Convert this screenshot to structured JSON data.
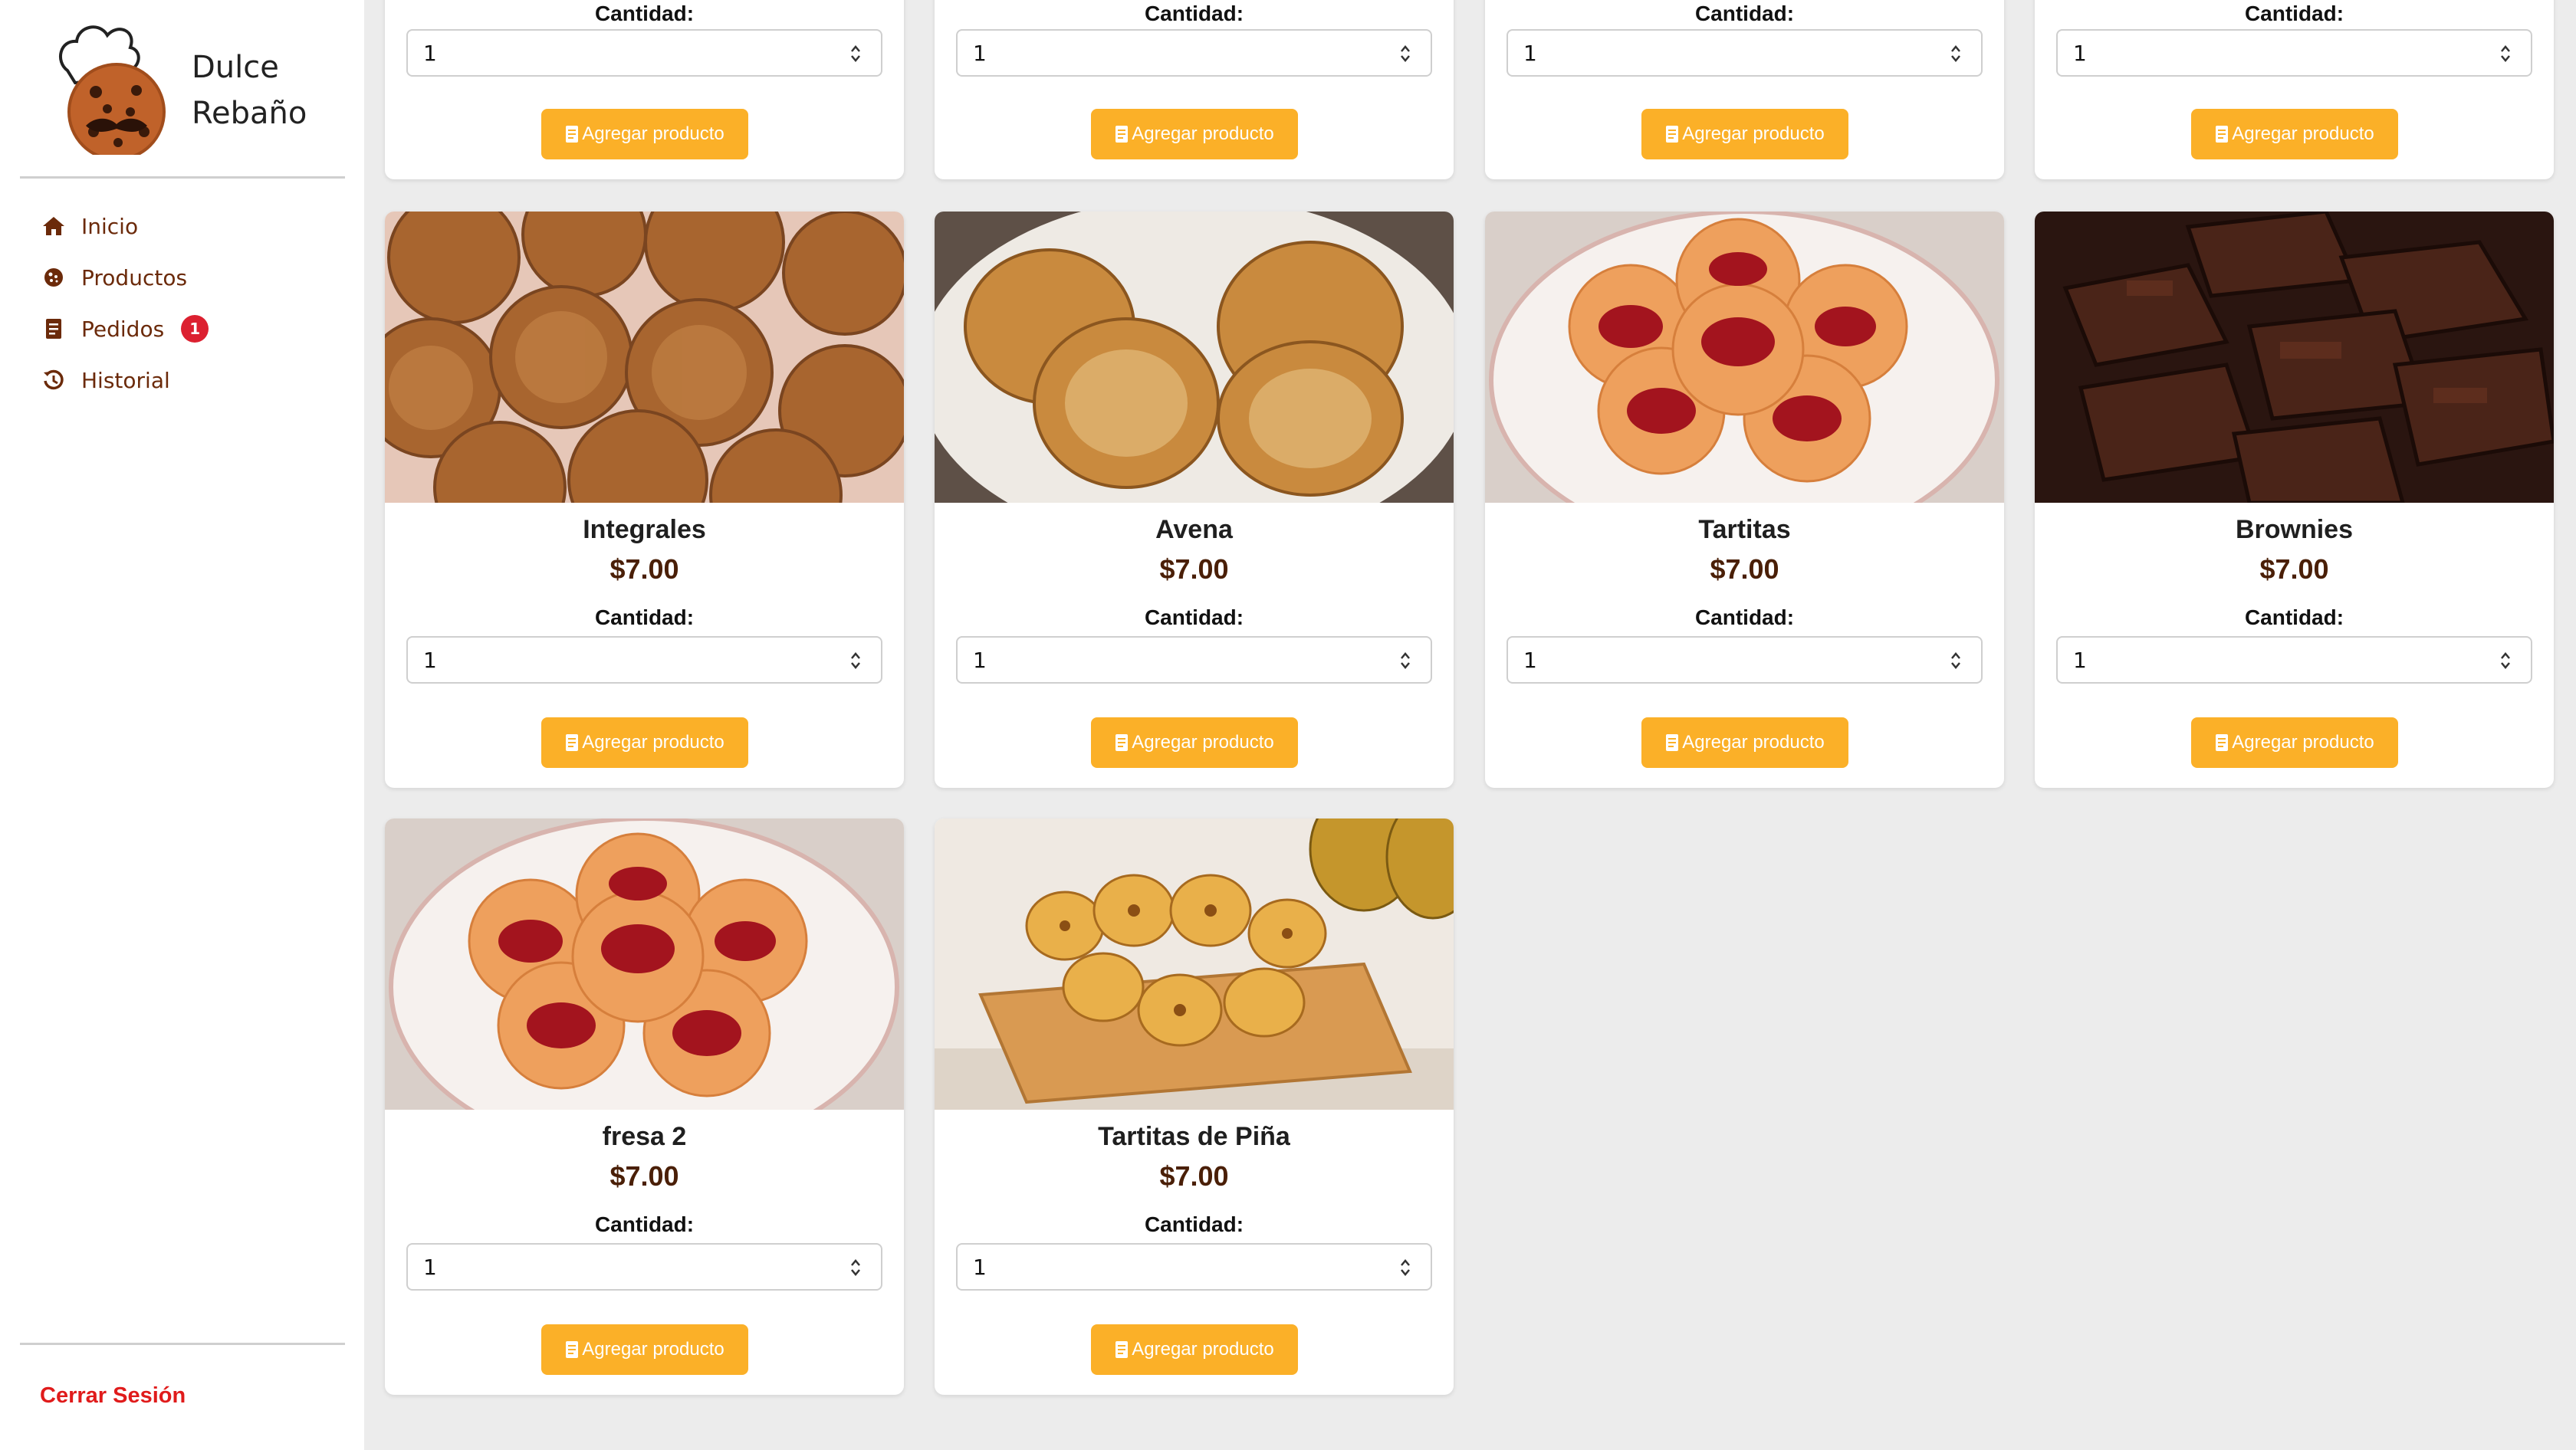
{
  "brand": {
    "line1": "Dulce",
    "line2": "Rebaño"
  },
  "nav": [
    {
      "label": "Inicio",
      "icon": "home-icon"
    },
    {
      "label": "Productos",
      "icon": "cookie-icon"
    },
    {
      "label": "Pedidos",
      "icon": "receipt-icon",
      "badge": "1"
    },
    {
      "label": "Historial",
      "icon": "history-icon"
    }
  ],
  "logout_label": "Cerrar Sesión",
  "colors": {
    "accent": "#fbb028",
    "brown": "#6b2a0a",
    "price": "#4a1f07",
    "badge": "#dc2030",
    "logout": "#e01b1b"
  },
  "qty_label": "Cantidad:",
  "add_label": "Agregar producto",
  "top_row_qty": [
    "1",
    "1",
    "1",
    "1"
  ],
  "products": [
    {
      "name": "Integrales",
      "price": "$7.00",
      "qty": "1"
    },
    {
      "name": "Avena",
      "price": "$7.00",
      "qty": "1"
    },
    {
      "name": "Tartitas",
      "price": "$7.00",
      "qty": "1"
    },
    {
      "name": "Brownies",
      "price": "$7.00",
      "qty": "1"
    },
    {
      "name": "fresa 2",
      "price": "$7.00",
      "qty": "1"
    },
    {
      "name": "Tartitas de Piña",
      "price": "$7.00",
      "qty": "1"
    }
  ]
}
